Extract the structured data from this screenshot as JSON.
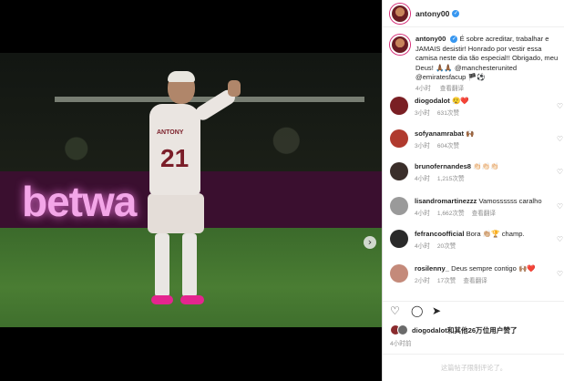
{
  "post": {
    "author": "antony00",
    "caption_text": "É sobre acreditar, trabalhar e JAMAIS desistir! Honrado por vestir essa camisa neste dia tão especial!! Obrigado, meu Deus! 🙏🏾🙏🏾 @manchesterunited @emiratesfacup 🏴⚽",
    "caption_time": "4小时",
    "caption_translate": "查看翻译"
  },
  "media": {
    "ad_text": "betwa",
    "shirt_name": "ANTONY",
    "shirt_number": "21",
    "next_icon": "›",
    "carousel_dots": 5,
    "active_dot": 0
  },
  "comments": [
    {
      "user": "diogodalot",
      "text": "😮‍💨❤️",
      "time": "3小时",
      "likes": "631次赞"
    },
    {
      "user": "sofyanamrabat",
      "text": "🙌🏾",
      "time": "3小时",
      "likes": "604次赞"
    },
    {
      "user": "brunofernandes8",
      "text": "👏🏻👏🏻👏🏻",
      "time": "4小时",
      "likes": "1,215次赞"
    },
    {
      "user": "lisandromartinezzz",
      "text": "Vamossssss caralho",
      "time": "4小时",
      "likes": "1,662次赞",
      "translate": "查看翻译"
    },
    {
      "user": "fefrancoofficial",
      "text": "Bora 👏🏼🏆 champ.",
      "time": "4小时",
      "likes": "20次赞"
    },
    {
      "user": "rosilenny_",
      "text": "Deus sempre contigo 🙌🏽❤️",
      "time": "2小时",
      "likes": "17次赞",
      "translate": "查看翻译"
    }
  ],
  "footer": {
    "likes_text_user": "diogodalot",
    "likes_text_rest": "和其他26万位用户赞了",
    "posted": "4小时前",
    "comments_closed": "这篇帖子限制评论了。"
  },
  "icons": [
    "heart-icon",
    "comment-icon",
    "share-icon",
    "verified-icon",
    "chevron-right-icon"
  ]
}
